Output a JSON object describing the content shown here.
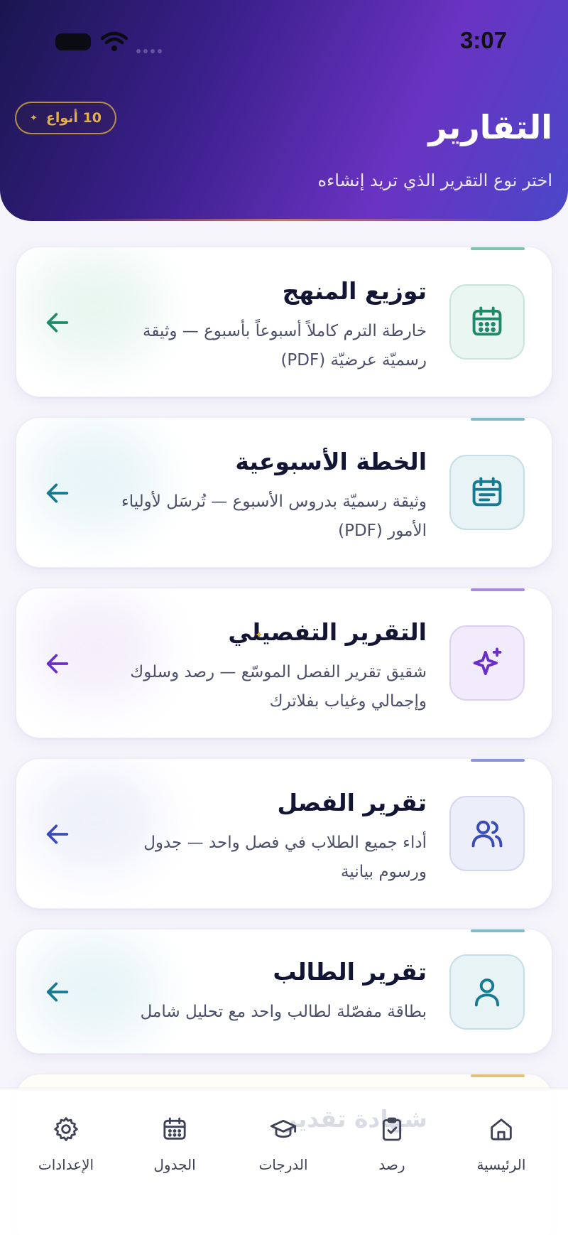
{
  "status_bar": {
    "time": "3:07"
  },
  "header": {
    "title": "التقارير",
    "subtitle": "اختر نوع التقرير الذي تريد إنشاءه",
    "types_badge": "10 أنواع",
    "badge_icon": "sparkle-icon"
  },
  "cards": [
    {
      "title": "توزيع المنهج",
      "desc": "خارطة الترم كاملاً أسبوعاً بأسبوع — وثيقة رسميّة عرضيّة (PDF)",
      "icon": "calendar-grid-icon",
      "accent": "#1f8a6a"
    },
    {
      "title": "الخطة الأسبوعية",
      "desc": "وثيقة رسميّة بدروس الأسبوع — تُرسَل لأولياء الأمور (PDF)",
      "icon": "calendar-lines-icon",
      "accent": "#157a92"
    },
    {
      "title": "التقرير التفصيلي",
      "desc": "شقيق تقرير الفصل الموسّع — رصد وسلوك وإجمالي وغياب بفلاترك",
      "icon": "sparkles-icon",
      "accent": "#6a2fc8"
    },
    {
      "title": "تقرير الفصل",
      "desc": "أداء جميع الطلاب في فصل واحد — جدول ورسوم بيانية",
      "icon": "users-icon",
      "accent": "#3a4bb8"
    },
    {
      "title": "تقرير الطالب",
      "desc": "بطاقة مفصّلة لطالب واحد مع تحليل شامل",
      "icon": "user-icon",
      "accent": "#157a92"
    }
  ],
  "peek_card": {
    "title": "شهادة تقدير"
  },
  "bottom_nav": [
    {
      "label": "الرئيسية",
      "icon": "home-icon"
    },
    {
      "label": "رصد",
      "icon": "clipboard-check-icon"
    },
    {
      "label": "الدرجات",
      "icon": "graduation-cap-icon"
    },
    {
      "label": "الجدول",
      "icon": "calendar-icon"
    },
    {
      "label": "الإعدادات",
      "icon": "gear-icon"
    }
  ]
}
